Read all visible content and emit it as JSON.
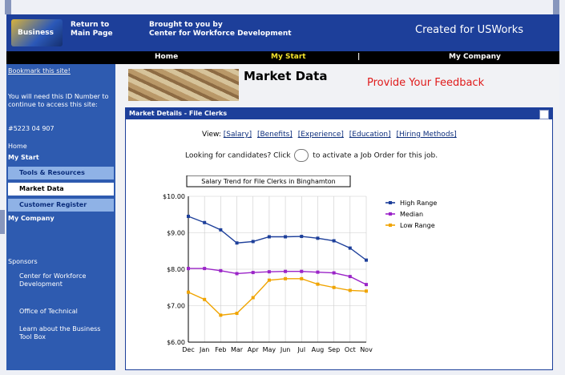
{
  "header": {
    "logo_text": "Business",
    "return_link": "Return to Main Page",
    "brought_by": "Brought to you by",
    "center": "Center for Workforce Development",
    "created_for": "Created for USWorks"
  },
  "nav": [
    "Home",
    "My Start",
    "My Company"
  ],
  "sidebar": {
    "text_1": "Bookmark this site!",
    "text_2": "You will need this ID Number to continue to access this site:",
    "id_number": "#5223 04 907",
    "home": "Home",
    "my_start": "My Start",
    "tools": "Tools & Resources",
    "market_data": "Market Data",
    "customer_register": "Customer Register",
    "my_company": "My Company",
    "sponsors": "Sponsors",
    "sponsor_1": "Center for Workforce Development",
    "sponsor_2": "Office of Technical",
    "learn": "Learn about the Business Tool Box"
  },
  "main": {
    "title": "Market Data",
    "feedback": "Provide Your Feedback",
    "panel_title": "Market Details - File Clerks",
    "view_label": "View:",
    "view_links": [
      "[Salary]",
      "[Benefits]",
      "[Experience]",
      "[Education]",
      "[Hiring Methods]"
    ],
    "lookrow_text_1": "Looking for candidates? Click",
    "lookrow_text_2": "to activate a Job Order for this job."
  },
  "chart_data": {
    "type": "line",
    "title": "Salary Trend for File Clerks in Binghamton",
    "categories": [
      "Dec",
      "Jan",
      "Feb",
      "Mar",
      "Apr",
      "May",
      "Jun",
      "Jul",
      "Aug",
      "Sep",
      "Oct",
      "Nov"
    ],
    "ylim": [
      6,
      10
    ],
    "y_ticks": [
      "$10.00",
      "$9.00",
      "$8.00",
      "$7.00",
      "$6.00"
    ],
    "series": [
      {
        "name": "High Range",
        "color": "#1d3f9a",
        "values": [
          9.45,
          9.28,
          9.08,
          8.72,
          8.76,
          8.89,
          8.89,
          8.9,
          8.85,
          8.78,
          8.58,
          8.25
        ]
      },
      {
        "name": "Median",
        "color": "#9b24c8",
        "values": [
          8.02,
          8.02,
          7.96,
          7.88,
          7.91,
          7.93,
          7.94,
          7.94,
          7.92,
          7.9,
          7.8,
          7.58
        ]
      },
      {
        "name": "Low Range",
        "color": "#f0a400",
        "values": [
          7.37,
          7.17,
          6.74,
          6.79,
          7.22,
          7.7,
          7.74,
          7.74,
          7.59,
          7.5,
          7.42,
          7.4
        ]
      }
    ]
  }
}
